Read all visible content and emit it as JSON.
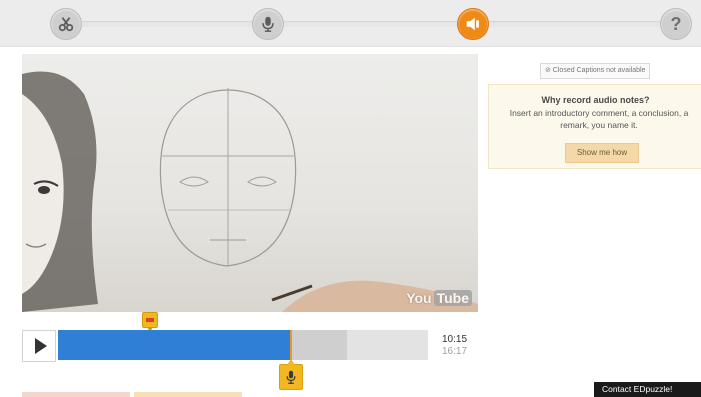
{
  "steps": [
    {
      "name": "cut",
      "icon": "scissors-icon",
      "state": "done"
    },
    {
      "name": "voiceover",
      "icon": "microphone-icon",
      "state": "done"
    },
    {
      "name": "audio-notes",
      "icon": "speaker-icon",
      "state": "active"
    },
    {
      "name": "quiz",
      "icon": "question-icon",
      "label": "?",
      "state": "todo"
    }
  ],
  "video": {
    "watermark_you": "You",
    "watermark_tube": "Tube"
  },
  "player": {
    "current_time": "10:15",
    "total_time": "16:17",
    "progress_fraction": 0.629,
    "buffered_fraction": 0.781
  },
  "captions_badge": "⊘ Closed Captions not available",
  "notes": {
    "title": "Why record audio notes?",
    "body": "Insert an introductory comment, a conclusion, a remark, you name it.",
    "button": "Show me how"
  },
  "contact_label": "Contact EDpuzzle!",
  "colors": {
    "accent_orange": "#f08a17",
    "progress_blue": "#2f7fd7",
    "marker_yellow": "#f3b721"
  }
}
